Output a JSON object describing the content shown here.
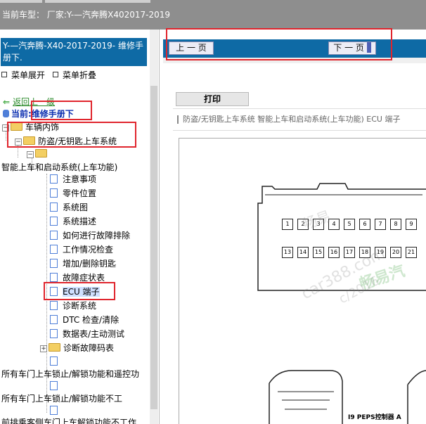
{
  "topbar": {
    "label": "当前车型：  厂家:Y-—汽奔腾X402017-2019"
  },
  "sidebar": {
    "title": "Y-—汽奔腾-X40-2017-2019- 维修手册下.",
    "expand_label": "菜单展开",
    "collapse_label": "菜单折叠",
    "back_label": "返回上一级",
    "current_label": "当前:维修手册下",
    "tree": {
      "level1": "车辆内饰",
      "level2": "防盗/无钥匙上车系统",
      "level3": "智能上车和启动系统(上车功能)",
      "items": [
        "注意事项",
        "零件位置",
        "系统图",
        "系统描述",
        "如何进行故障排除",
        "工作情况检查",
        "增加/删除钥匙",
        "故障症状表",
        "ECU 端子",
        "诊断系统",
        "DTC 检查/清除",
        "数据表/主动测试",
        "诊断故障码表"
      ],
      "bottom_items": [
        "所有车门上车锁止/解锁功能和遥控功",
        "所有车门上车锁止/解锁功能不工",
        "前排乘客侧车门上车解锁功能不工作"
      ]
    }
  },
  "nav": {
    "prev_label": "上 一 页",
    "next_label": "下 一 页"
  },
  "content": {
    "print_label": "打印",
    "doc_title": "防盗/无钥匙上车系统  智能上车和启动系统(上车功能)  ECU 端子",
    "connector_caption": "I9 PEPS控制器 A",
    "pins_row1": [
      "1",
      "2",
      "3",
      "4",
      "5",
      "6",
      "7",
      "8",
      "9"
    ],
    "pins_row2": [
      "13",
      "14",
      "15",
      "16",
      "17",
      "18",
      "19",
      "20",
      "21"
    ],
    "watermarks": [
      "畅易",
      "car388.com",
      "畅易汽",
      "c/2016"
    ]
  },
  "colors": {
    "header_blue": "#0e6aa5",
    "highlight_red": "#e0252d",
    "link_green": "#2a8a2a"
  }
}
